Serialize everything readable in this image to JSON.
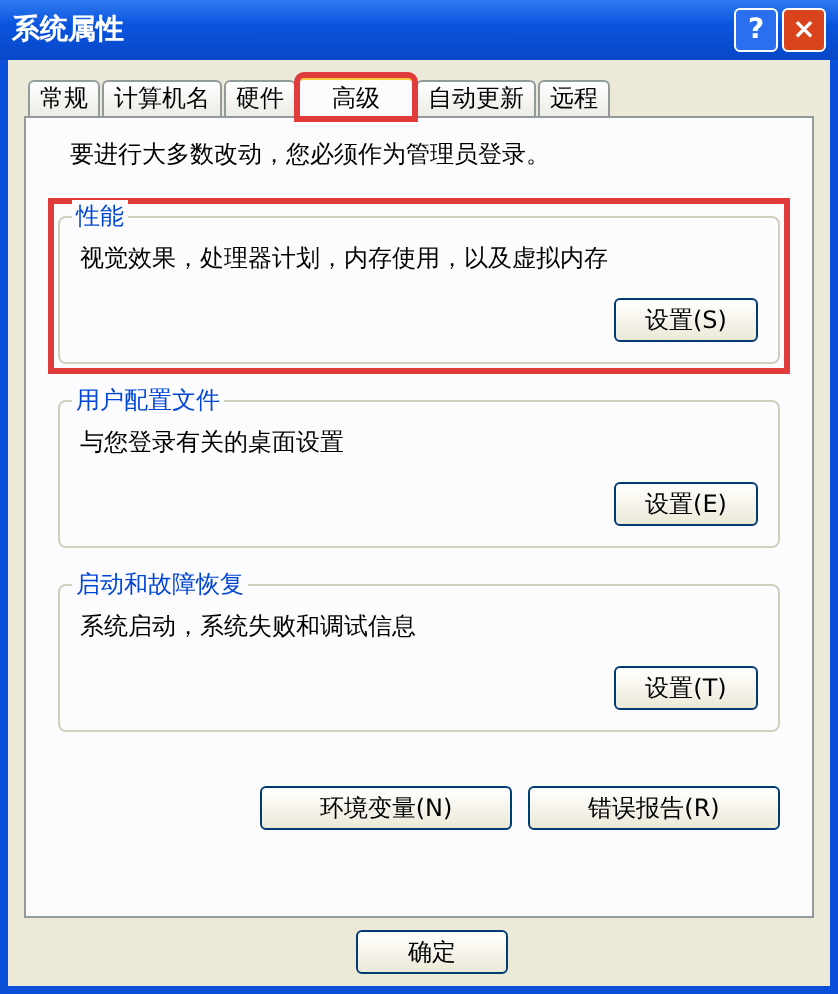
{
  "window": {
    "title": "系统属性",
    "help": "?",
    "close": "×"
  },
  "tabs": [
    {
      "label": "常规",
      "selected": false,
      "highlighted": false
    },
    {
      "label": "计算机名",
      "selected": false,
      "highlighted": false
    },
    {
      "label": "硬件",
      "selected": false,
      "highlighted": false
    },
    {
      "label": "高级",
      "selected": true,
      "highlighted": true
    },
    {
      "label": "自动更新",
      "selected": false,
      "highlighted": false
    },
    {
      "label": "远程",
      "selected": false,
      "highlighted": false
    }
  ],
  "notice": "要进行大多数改动，您必须作为管理员登录。",
  "groups": [
    {
      "title": "性能",
      "description": "视觉效果，处理器计划，内存使用，以及虚拟内存",
      "button": "设置(S)",
      "highlighted": true
    },
    {
      "title": "用户配置文件",
      "description": "与您登录有关的桌面设置",
      "button": "设置(E)",
      "highlighted": false
    },
    {
      "title": "启动和故障恢复",
      "description": "系统启动，系统失败和调试信息",
      "button": "设置(T)",
      "highlighted": false
    }
  ],
  "panel_buttons": [
    "环境变量(N)",
    "错误报告(R)"
  ],
  "dialog_buttons": [
    "确定"
  ]
}
